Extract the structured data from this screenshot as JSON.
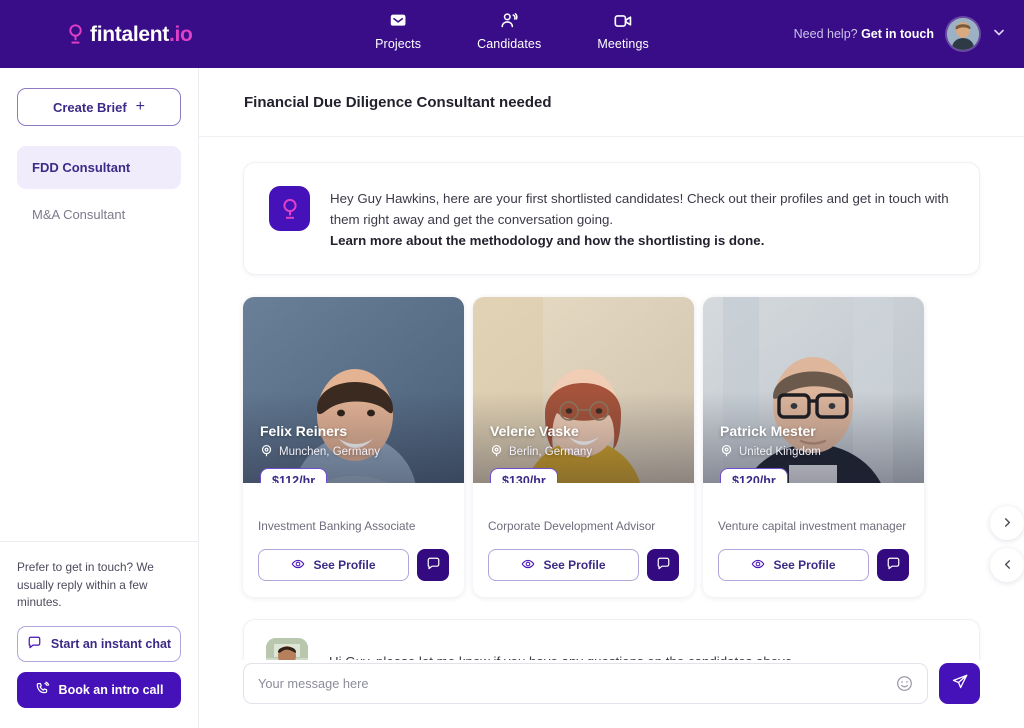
{
  "header": {
    "logo_text": "fintalent",
    "logo_tld": ".io",
    "logo_icon": "fintalent-pin-logo-icon",
    "nav": [
      {
        "label": "Projects",
        "icon": "inbox-tray-icon"
      },
      {
        "label": "Candidates",
        "icon": "people-icon"
      },
      {
        "label": "Meetings",
        "icon": "video-camera-icon"
      }
    ],
    "help_prefix": "Need help? ",
    "help_link": "Get in touch",
    "avatar_icon": "user-avatar",
    "chevron_icon": "chevron-down-icon"
  },
  "sidebar": {
    "create_brief_label": "Create Brief",
    "create_brief_plus": "+",
    "projects": [
      {
        "label": "FDD Consultant",
        "active": true
      },
      {
        "label": "M&A Consultant",
        "active": false
      }
    ],
    "contact_note": "Prefer to get in touch? We usually reply within a few minutes.",
    "instant_chat_label": "Start an instant chat",
    "instant_chat_icon": "chat-bubble-icon",
    "intro_call_label": "Book an intro call",
    "intro_call_icon": "phone-call-icon"
  },
  "main": {
    "page_title": "Financial Due Diligence Consultant needed",
    "banner": {
      "logo_icon": "fintalent-pin-logo-icon",
      "line1": "Hey Guy Hawkins, here are your first shortlisted candidates! Check out their profiles and get in touch with them right away and get the conversation going.",
      "line2": "Learn more about the methodology and how the shortlisting is done."
    },
    "candidates": [
      {
        "name": "Felix Reiners",
        "location": "Munchen, Germany",
        "rate": "$112/hr",
        "role": "Investment Banking Associate",
        "see_profile_label": "See Profile",
        "location_icon": "map-pin-icon",
        "eye_icon": "eye-icon",
        "chat_icon": "chat-bubble-icon",
        "photo_bg": "#5c7390",
        "skin": "#e3b394",
        "hair": "#3b2a20",
        "shirt": "#8fa6bd"
      },
      {
        "name": "Velerie Vaske",
        "location": "Berlin, Germany",
        "rate": "$130/hr",
        "role": "Corporate Development Advisor",
        "see_profile_label": "See Profile",
        "location_icon": "map-pin-icon",
        "eye_icon": "eye-icon",
        "chat_icon": "chat-bubble-icon",
        "photo_bg": "#ddd2bd",
        "skin": "#f0cdb4",
        "hair": "#a5533a",
        "shirt": "#cfa227"
      },
      {
        "name": "Patrick Mester",
        "location": "United Kingdom",
        "rate": "$120/hr",
        "role": "Venture capital investment manager",
        "see_profile_label": "See Profile",
        "location_icon": "map-pin-icon",
        "eye_icon": "eye-icon",
        "chat_icon": "chat-bubble-icon",
        "photo_bg": "#c9ced2",
        "skin": "#ddb69c",
        "hair": "#6b5a4c",
        "shirt": "#1d2330"
      }
    ],
    "carousel": {
      "next_icon": "chevron-right-icon",
      "prev_icon": "chevron-left-icon"
    },
    "agent_message": {
      "avatar_icon": "agent-avatar",
      "text": "Hi Guy, please let me know if you have any questions on the candidates above."
    },
    "composer": {
      "placeholder": "Your message here",
      "value": "",
      "emoji_icon": "smiley-icon",
      "send_icon": "send-paper-plane-icon"
    }
  },
  "colors": {
    "header_purple": "#380d87",
    "accent_purple": "#4511b8",
    "deep_purple": "#330a7f",
    "brand_pink": "#e040c8",
    "active_item_bg": "#f0ecfb"
  }
}
